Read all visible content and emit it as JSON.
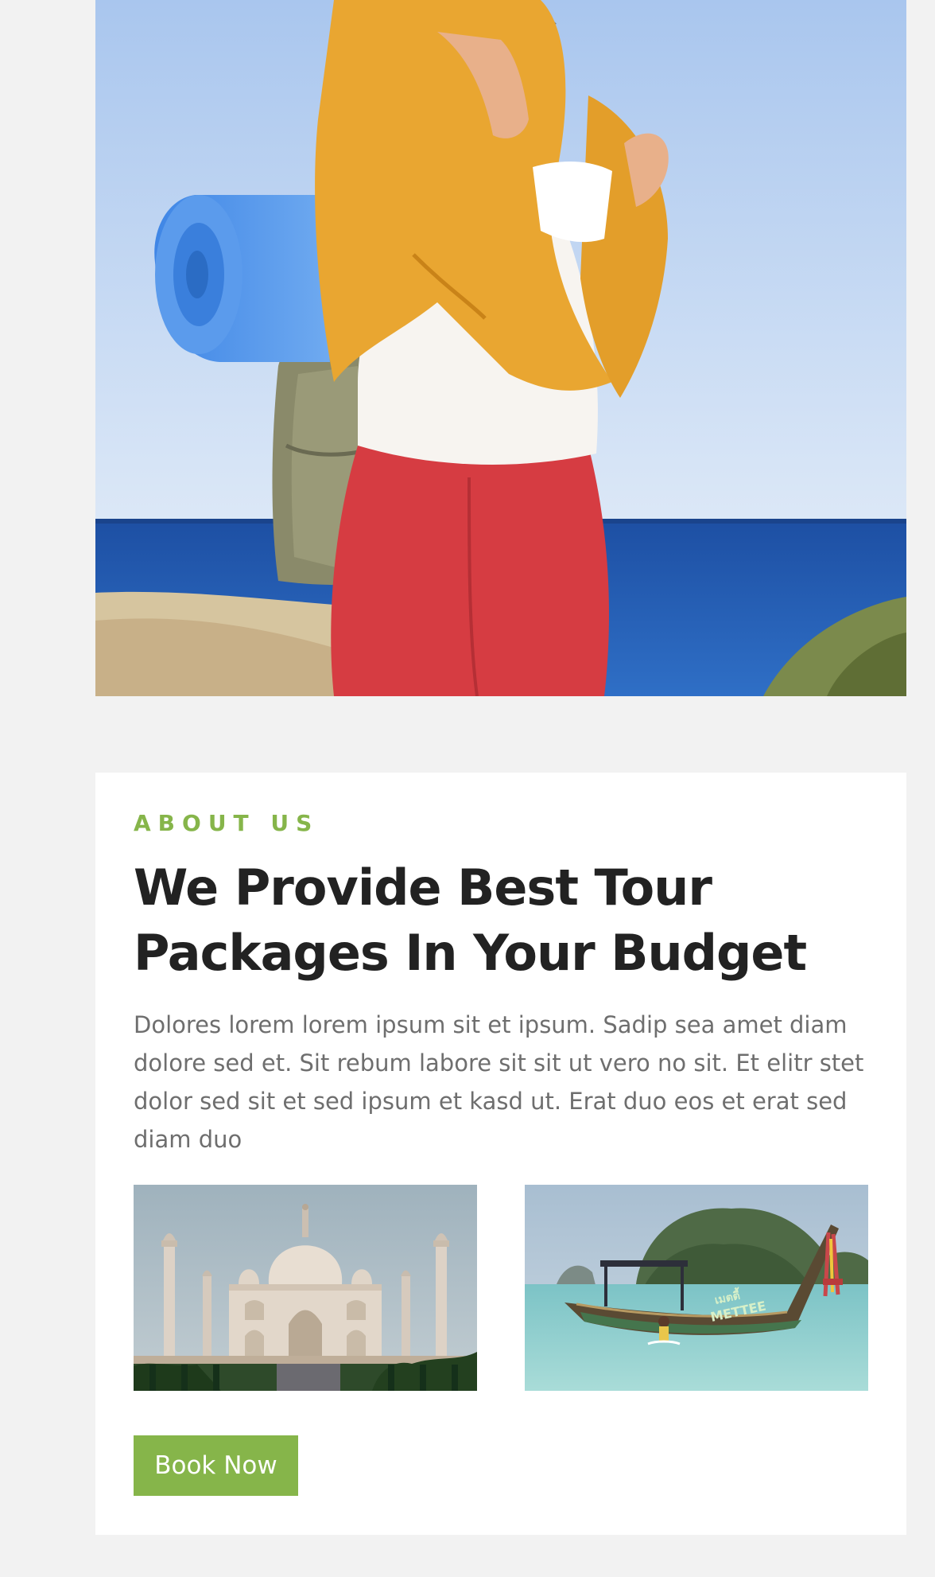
{
  "about": {
    "eyebrow": "ABOUT US",
    "title": "We Provide Best Tour Packages In Your Budget",
    "description": "Dolores lorem lorem ipsum sit et ipsum. Sadip sea amet diam dolore sed et. Sit rebum labore sit sit ut vero no sit. Et elitr stet dolor sed sit et sed ipsum et kasd ut. Erat duo eos et erat sed diam duo",
    "button_label": "Book Now"
  },
  "boat_sign": {
    "line1": "เมตตี้",
    "line2": "METTEE"
  },
  "colors": {
    "accent": "#86b54a",
    "heading": "#222222",
    "body_text": "#6e6e6e",
    "page_background": "#f2f2f2",
    "card_background": "#ffffff"
  },
  "icons": {
    "hero": "hiker-photo",
    "left_thumbnail": "taj-mahal-photo",
    "right_thumbnail": "longtail-boat-photo"
  }
}
